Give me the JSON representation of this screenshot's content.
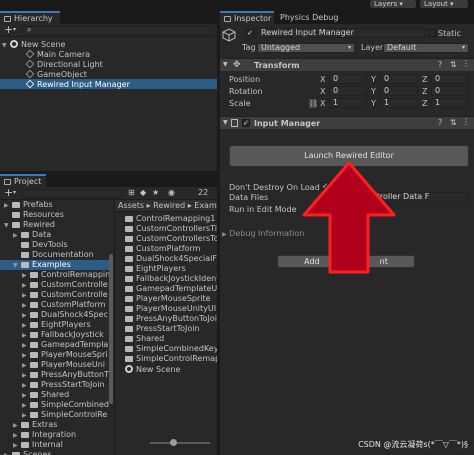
{
  "topbar": {
    "layers_label": "Layers",
    "layout_label": "Layout"
  },
  "hierarchy": {
    "tab_label": "Hierarchy",
    "add_label": "+",
    "search_placeholder": "All",
    "scene": "New Scene",
    "items": [
      "Main Camera",
      "Directional Light",
      "GameObject",
      "Rewired Input Manager"
    ]
  },
  "project": {
    "tab_label": "Project",
    "add_label": "+",
    "counter": "22",
    "breadcrumb": [
      "Assets",
      "Rewired",
      "Examp"
    ],
    "tree": [
      {
        "label": "Prefabs",
        "indent": 1,
        "arrow": "▶"
      },
      {
        "label": "Resources",
        "indent": 1,
        "arrow": ""
      },
      {
        "label": "Rewired",
        "indent": 1,
        "arrow": "▼"
      },
      {
        "label": "Data",
        "indent": 2,
        "arrow": "▶"
      },
      {
        "label": "DevTools",
        "indent": 2,
        "arrow": ""
      },
      {
        "label": "Documentation",
        "indent": 2,
        "arrow": ""
      },
      {
        "label": "Examples",
        "indent": 2,
        "arrow": "▼",
        "selected": true
      },
      {
        "label": "ControlRemappin",
        "indent": 3,
        "arrow": "▶"
      },
      {
        "label": "CustomControlle",
        "indent": 3,
        "arrow": "▶"
      },
      {
        "label": "CustomControlle",
        "indent": 3,
        "arrow": "▶"
      },
      {
        "label": "CustomPlatform",
        "indent": 3,
        "arrow": "▶"
      },
      {
        "label": "DualShock4Spec",
        "indent": 3,
        "arrow": "▶"
      },
      {
        "label": "EightPlayers",
        "indent": 3,
        "arrow": "▶"
      },
      {
        "label": "FallbackJoystick",
        "indent": 3,
        "arrow": "▶"
      },
      {
        "label": "GamepadTemplat",
        "indent": 3,
        "arrow": "▶"
      },
      {
        "label": "PlayerMouseSpri",
        "indent": 3,
        "arrow": "▶"
      },
      {
        "label": "PlayerMouseUni",
        "indent": 3,
        "arrow": "▶"
      },
      {
        "label": "PressAnyButtonT",
        "indent": 3,
        "arrow": "▶"
      },
      {
        "label": "PressStartToJoin",
        "indent": 3,
        "arrow": "▶"
      },
      {
        "label": "Shared",
        "indent": 3,
        "arrow": "▶"
      },
      {
        "label": "SimpleCombined",
        "indent": 3,
        "arrow": "▶"
      },
      {
        "label": "SimpleControlRe",
        "indent": 3,
        "arrow": "▶"
      },
      {
        "label": "Extras",
        "indent": 2,
        "arrow": "▶"
      },
      {
        "label": "Integration",
        "indent": 2,
        "arrow": "▶"
      },
      {
        "label": "Internal",
        "indent": 2,
        "arrow": "▶"
      },
      {
        "label": "Scenes",
        "indent": 1,
        "arrow": "▶"
      }
    ],
    "files": [
      "ControlRemapping1",
      "CustomControllersTilt",
      "CustomControllersTouc",
      "CustomPlatform",
      "DualShock4SpecialFea",
      "EightPlayers",
      "FallbackJoystickIdenti",
      "GamepadTemplateUI",
      "PlayerMouseSprite",
      "PlayerMouseUnityUI",
      "PressAnyButtonToJoin",
      "PressStartToJoin",
      "Shared",
      "SimpleCombinedKeybo",
      "SimpleControlRemappi",
      "New Scene"
    ]
  },
  "inspector": {
    "tab_label": "Inspector",
    "tab2_label": "Physics Debug",
    "object_name": "Rewired Input Manager",
    "static_label": "Static",
    "tag_label": "Tag",
    "tag_value": "Untagged",
    "layer_label": "Layer",
    "layer_value": "Default",
    "transform": {
      "title": "Transform",
      "rows": [
        {
          "label": "Position",
          "x": "0",
          "y": "0",
          "z": "0"
        },
        {
          "label": "Rotation",
          "x": "0",
          "y": "0",
          "z": "0"
        },
        {
          "label": "Scale",
          "x": "1",
          "y": "1",
          "z": "1"
        }
      ]
    },
    "input_manager": {
      "title": "Input Manager",
      "launch_button": "Launch Rewired Editor",
      "dont_destroy_label": "Don't Destroy On Load",
      "data_files_label": "Data Files",
      "data_files_value": "ataFiles (Controller Data F",
      "run_in_edit_label": "Run in Edit Mode",
      "debug_label": "Debug Information",
      "add_button_left": "Add",
      "add_button_right": "nt"
    }
  },
  "watermark": "CSDN @流云凝荷s(*￣▽￣*)§",
  "colors": {
    "accent": "#3a79bb",
    "selection": "#2c5d87",
    "arrow_red": "#d2001e"
  }
}
